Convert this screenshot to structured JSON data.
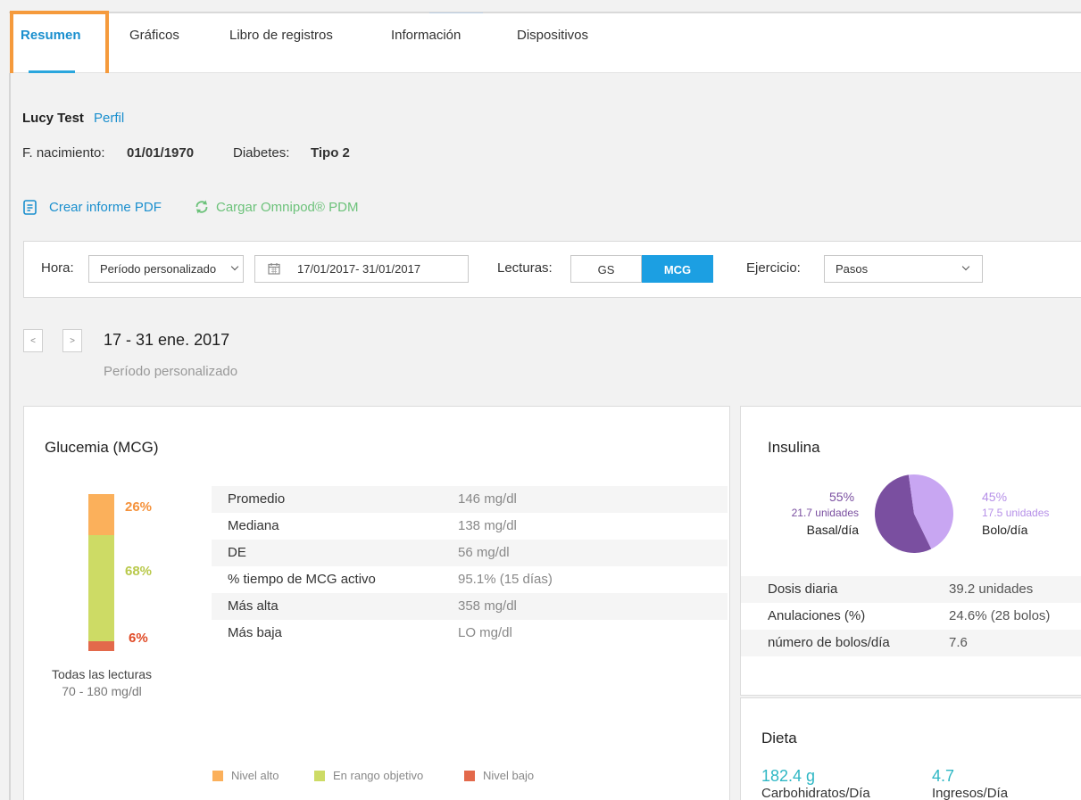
{
  "tabs": [
    {
      "label": "Resumen",
      "active": true
    },
    {
      "label": "Gráficos"
    },
    {
      "label": "Libro de registros"
    },
    {
      "label": "Información"
    },
    {
      "label": "Dispositivos"
    }
  ],
  "patient": {
    "name": "Lucy Test",
    "profile_link": "Perfil",
    "dob_label": "F. nacimiento:",
    "dob_value": "01/01/1970",
    "diabetes_label": "Diabetes:",
    "diabetes_value": "Tipo 2"
  },
  "actions": {
    "pdf": "Crear informe PDF",
    "upload": "Cargar Omnipod® PDM"
  },
  "filters": {
    "time_label": "Hora:",
    "time_value": "Período personalizado",
    "date_range": "17/01/2017- 31/01/2017",
    "readings_label": "Lecturas:",
    "readings_options": [
      "GS",
      "MCG"
    ],
    "readings_selected": "MCG",
    "exercise_label": "Ejercicio:",
    "exercise_value": "Pasos"
  },
  "period": {
    "prev": "<",
    "next": ">",
    "title": "17 - 31 ene. 2017",
    "subtitle": "Período personalizado"
  },
  "glucose": {
    "title": "Glucemia (MCG)",
    "distribution": [
      {
        "label": "Nivel alto",
        "percent": 26,
        "display": "26%",
        "color": "#fbb05b"
      },
      {
        "label": "En rango objetivo",
        "percent": 68,
        "display": "68%",
        "color": "#cddb65"
      },
      {
        "label": "Nivel bajo",
        "percent": 6,
        "display": "6%",
        "color": "#e3694b"
      }
    ],
    "bar_caption": "Todas las lecturas",
    "bar_range": "70 - 180 mg/dl",
    "stats": [
      {
        "label": "Promedio",
        "value": "146 mg/dl"
      },
      {
        "label": "Mediana",
        "value": "138 mg/dl"
      },
      {
        "label": "DE",
        "value": "56 mg/dl"
      },
      {
        "label": "% tiempo de MCG activo",
        "value": "95.1% (15 días)"
      },
      {
        "label": "Más alta",
        "value": "358 mg/dl"
      },
      {
        "label": "Más baja",
        "value": "LO mg/dl"
      }
    ]
  },
  "insulin": {
    "title": "Insulina",
    "basal": {
      "percent": 55,
      "display": "55%",
      "units": "21.7 unidades",
      "label": "Basal/día",
      "color": "#7a4fa0"
    },
    "bolus": {
      "percent": 45,
      "display": "45%",
      "units": "17.5 unidades",
      "label": "Bolo/día",
      "color": "#c8a6f2"
    },
    "stats": [
      {
        "label": "Dosis diaria",
        "value": "39.2 unidades"
      },
      {
        "label": "Anulaciones (%)",
        "value": "24.6% (28 bolos)"
      },
      {
        "label": "número de bolos/día",
        "value": "7.6"
      }
    ]
  },
  "diet": {
    "title": "Dieta",
    "carbs_value": "182.4 g",
    "carbs_label": "Carbohidratos/Día",
    "entries_value": "4.7",
    "entries_label": "Ingresos/Día"
  }
}
